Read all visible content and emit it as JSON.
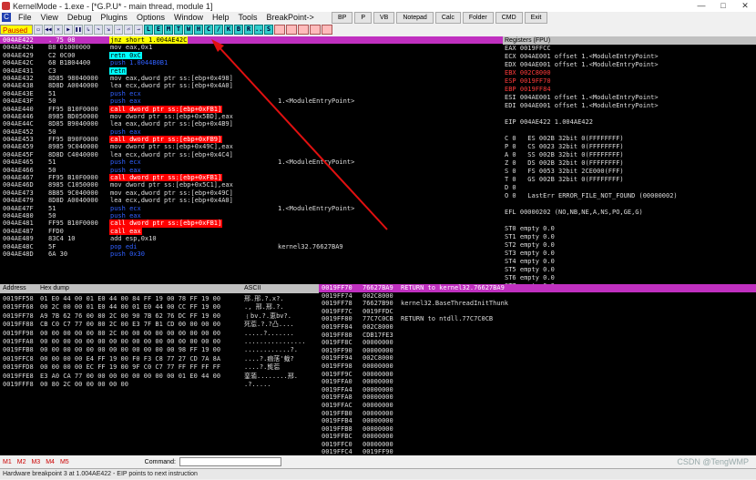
{
  "window": {
    "title": "KernelMode - 1.exe - [*G.P.U* - main thread, module 1]",
    "controls": [
      "—",
      "□",
      "✕"
    ]
  },
  "menu": [
    "File",
    "View",
    "Debug",
    "Plugins",
    "Options",
    "Window",
    "Help",
    "Tools",
    "BreakPoint->"
  ],
  "plugin_buttons": [
    "BP",
    "P",
    "VB",
    "Notepad",
    "Calc",
    "Folder",
    "CMD",
    "Exit"
  ],
  "toolbar": {
    "status": "Paused",
    "letters": [
      "L",
      "E",
      "M",
      "T",
      "W",
      "H",
      "C",
      "/",
      "K",
      "B",
      "R",
      "...",
      "S"
    ],
    "icons": [
      "open-icon",
      "rewind-icon",
      "close-icon",
      "play-icon",
      "pause-icon",
      "step-into-icon",
      "step-over-icon",
      "trace-into-icon",
      "trace-over-icon",
      "exec-till-return-icon",
      "goto-icon"
    ]
  },
  "disasm": {
    "rows": [
      {
        "addr": "004AE422",
        "hex": ". 75 08",
        "ins": "jnz short 1.004AE42C",
        "cmt": "",
        "kind": "jmp",
        "sel": true
      },
      {
        "addr": "004AE424",
        "hex": "B8 01000000",
        "ins": "mov eax,0x1",
        "cmt": "",
        "kind": "plain"
      },
      {
        "addr": "004AE429",
        "hex": "C2 0C00",
        "ins": "retn 0xC",
        "cmt": "",
        "kind": "ret"
      },
      {
        "addr": "004AE42C",
        "hex": "68 B1B04400",
        "ins": "push 1.0044B0B1",
        "cmt": "",
        "kind": "push"
      },
      {
        "addr": "004AE431",
        "hex": "C3",
        "ins": "retn",
        "cmt": "",
        "kind": "ret"
      },
      {
        "addr": "004AE432",
        "hex": "8D85 98040000",
        "ins": "mov eax,dword ptr ss:[ebp+0x498]",
        "cmt": "",
        "kind": "plain"
      },
      {
        "addr": "004AE438",
        "hex": "8D8D A0040000",
        "ins": "lea ecx,dword ptr ss:[ebp+0x4A0]",
        "cmt": "",
        "kind": "plain"
      },
      {
        "addr": "004AE43E",
        "hex": "51",
        "ins": "push ecx",
        "cmt": "",
        "kind": "push"
      },
      {
        "addr": "004AE43F",
        "hex": "50",
        "ins": "push eax",
        "cmt": "1.<ModuleEntryPoint>",
        "kind": "push"
      },
      {
        "addr": "004AE440",
        "hex": "FF95 B10F0000",
        "ins": "call dword ptr ss:[ebp+0xFB1]",
        "cmt": "",
        "kind": "call"
      },
      {
        "addr": "004AE446",
        "hex": "8985 BD050000",
        "ins": "mov dword ptr ss:[ebp+0x5BD],eax",
        "cmt": "",
        "kind": "plain"
      },
      {
        "addr": "004AE44C",
        "hex": "8D85 B9040000",
        "ins": "lea eax,dword ptr ss:[ebp+0x4B9]",
        "cmt": "",
        "kind": "plain"
      },
      {
        "addr": "004AE452",
        "hex": "50",
        "ins": "push eax",
        "cmt": "",
        "kind": "push"
      },
      {
        "addr": "004AE453",
        "hex": "FF95 B90F0000",
        "ins": "call dword ptr ss:[ebp+0xFB9]",
        "cmt": "",
        "kind": "call"
      },
      {
        "addr": "004AE459",
        "hex": "8985 9C040000",
        "ins": "mov dword ptr ss:[ebp+0x49C],eax",
        "cmt": "",
        "kind": "plain"
      },
      {
        "addr": "004AE45F",
        "hex": "8D8D C4040000",
        "ins": "lea ecx,dword ptr ss:[ebp+0x4C4]",
        "cmt": "",
        "kind": "plain"
      },
      {
        "addr": "004AE465",
        "hex": "51",
        "ins": "push ecx",
        "cmt": "1.<ModuleEntryPoint>",
        "kind": "push"
      },
      {
        "addr": "004AE466",
        "hex": "50",
        "ins": "push eax",
        "cmt": "",
        "kind": "push"
      },
      {
        "addr": "004AE467",
        "hex": "FF95 B10F0000",
        "ins": "call dword ptr ss:[ebp+0xFB1]",
        "cmt": "",
        "kind": "call"
      },
      {
        "addr": "004AE46D",
        "hex": "8985 C1050000",
        "ins": "mov dword ptr ss:[ebp+0x5C1],eax",
        "cmt": "",
        "kind": "plain"
      },
      {
        "addr": "004AE473",
        "hex": "8B85 9C040000",
        "ins": "mov eax,dword ptr ss:[ebp+0x49C]",
        "cmt": "",
        "kind": "plain"
      },
      {
        "addr": "004AE479",
        "hex": "8D8D A0040000",
        "ins": "lea ecx,dword ptr ss:[ebp+0x4A0]",
        "cmt": "",
        "kind": "plain"
      },
      {
        "addr": "004AE47F",
        "hex": "51",
        "ins": "push ecx",
        "cmt": "1.<ModuleEntryPoint>",
        "kind": "push"
      },
      {
        "addr": "004AE480",
        "hex": "50",
        "ins": "push eax",
        "cmt": "",
        "kind": "push"
      },
      {
        "addr": "004AE481",
        "hex": "FF95 B10F0000",
        "ins": "call dword ptr ss:[ebp+0xFB1]",
        "cmt": "",
        "kind": "call"
      },
      {
        "addr": "004AE487",
        "hex": "FFD0",
        "ins": "call eax",
        "cmt": "",
        "kind": "call"
      },
      {
        "addr": "004AE489",
        "hex": "83C4 10",
        "ins": "add esp,0x10",
        "cmt": "",
        "kind": "plain"
      },
      {
        "addr": "004AE48C",
        "hex": "5F",
        "ins": "pop edi",
        "cmt": "kernel32.76627BA9",
        "kind": "push"
      },
      {
        "addr": "004AE48D",
        "hex": "6A 30",
        "ins": "push 0x30",
        "cmt": "",
        "kind": "push"
      }
    ]
  },
  "registers": {
    "title": "Registers (FPU)",
    "lines": [
      {
        "t": "EAX 0019FFCC",
        "red": false
      },
      {
        "t": "ECX 004AE001 offset 1.<ModuleEntryPoint>",
        "red": false
      },
      {
        "t": "EDX 004AE001 offset 1.<ModuleEntryPoint>",
        "red": false
      },
      {
        "t": "EBX 002C8000",
        "red": true
      },
      {
        "t": "ESP 0019FF70",
        "red": true
      },
      {
        "t": "EBP 0019FF84",
        "red": true
      },
      {
        "t": "ESI 004AE001 offset 1.<ModuleEntryPoint>",
        "red": false
      },
      {
        "t": "EDI 004AE001 offset 1.<ModuleEntryPoint>",
        "red": false
      },
      {
        "t": "",
        "red": false
      },
      {
        "t": "EIP 004AE422 1.004AE422",
        "red": false
      },
      {
        "t": "",
        "red": false
      },
      {
        "t": "C 0   ES 002B 32bit 0(FFFFFFFF)",
        "red": false
      },
      {
        "t": "P 0   CS 0023 32bit 0(FFFFFFFF)",
        "red": false
      },
      {
        "t": "A 0   SS 002B 32bit 0(FFFFFFFF)",
        "red": false
      },
      {
        "t": "Z 0   DS 002B 32bit 0(FFFFFFFF)",
        "red": false
      },
      {
        "t": "S 0   FS 0053 32bit 2CE000(FFF)",
        "red": false
      },
      {
        "t": "T 0   GS 002B 32bit 0(FFFFFFFF)",
        "red": false
      },
      {
        "t": "D 0",
        "red": false
      },
      {
        "t": "O 0   LastErr ERROR_FILE_NOT_FOUND (00000002)",
        "red": false
      },
      {
        "t": "",
        "red": false
      },
      {
        "t": "EFL 00000202 (NO,NB,NE,A,NS,PO,GE,G)",
        "red": false
      },
      {
        "t": "",
        "red": false
      },
      {
        "t": "ST0 empty 0.0",
        "red": false
      },
      {
        "t": "ST1 empty 0.0",
        "red": false
      },
      {
        "t": "ST2 empty 0.0",
        "red": false
      },
      {
        "t": "ST3 empty 0.0",
        "red": false
      },
      {
        "t": "ST4 empty 0.0",
        "red": false
      },
      {
        "t": "ST5 empty 0.0",
        "red": false
      },
      {
        "t": "ST6 empty 0.0",
        "red": false
      },
      {
        "t": "ST7 empty 0.0",
        "red": false
      }
    ]
  },
  "dump": {
    "headers": [
      "Address",
      "Hex dump",
      "ASCII"
    ],
    "rows": [
      {
        "a": "0019FF58",
        "h": "01 E0 44 00 01 E0 44 00 84 FF 19 00 78 FF 19 00",
        "s": "邢.邢.?.x?."
      },
      {
        "a": "0019FF68",
        "h": "00 2C 00 00 01 E0 44 00 01 E0 44 00 CC FF 19 00",
        "s": "., 邢.邢.?."
      },
      {
        "a": "0019FF78",
        "h": "A9 7B 62 76 00 80 2C 00 90 7B 62 76 DC FF 19 00",
        "s": "﹛bv.?.恵bv?."
      },
      {
        "a": "0019FF88",
        "h": "CB C0 C7 77 00 80 2C 00 E3 7F B1 CD 00 00 00 00",
        "s": "死莣.?.?凸...."
      },
      {
        "a": "0019FF98",
        "h": "00 00 00 00 00 80 2C 00 00 00 00 00 00 00 00 00",
        "s": ".....?......."
      },
      {
        "a": "0019FFA8",
        "h": "00 00 00 00 00 00 00 00 00 00 00 00 00 00 00 00",
        "s": "................"
      },
      {
        "a": "0019FFB8",
        "h": "00 00 00 00 00 00 00 00 00 00 00 00 98 FF 19 00",
        "s": "............?."
      },
      {
        "a": "0019FFC8",
        "h": "00 00 00 00 E4 FF 19 00 F0 F3 C8 77 27 CD 7A 8A",
        "s": "....?.痼萿'蛓?"
      },
      {
        "a": "0019FFD8",
        "h": "00 00 00 00 EC FF 19 00 9F C0 C7 77 FF FF FF FF",
        "s": "....?.熋莣"
      },
      {
        "a": "0019FFE8",
        "h": "E3 A0 CA 77 00 00 00 00 00 00 00 00 01 E0 44 00",
        "s": "銮蕍........邢."
      },
      {
        "a": "0019FFF8",
        "h": "00 80 2C 00 00 00 00 00",
        "s": ".?....."
      }
    ]
  },
  "stack": {
    "rows": [
      {
        "a": "0019FF70",
        "v": "76627BA9",
        "c": "RETURN to kernel32.76627BA9",
        "sel": true
      },
      {
        "a": "0019FF74",
        "v": "002C8000",
        "c": ""
      },
      {
        "a": "0019FF78",
        "v": "76627B90",
        "c": "kernel32.BaseThreadInitThunk"
      },
      {
        "a": "0019FF7C",
        "v": "0019FFDC",
        "c": ""
      },
      {
        "a": "0019FF80",
        "v": "77C7C0CB",
        "c": "RETURN to ntdll.77C7C0CB"
      },
      {
        "a": "0019FF84",
        "v": "002C8000",
        "c": ""
      },
      {
        "a": "0019FF88",
        "v": "CDB17FE3",
        "c": ""
      },
      {
        "a": "0019FF8C",
        "v": "00000000",
        "c": ""
      },
      {
        "a": "0019FF90",
        "v": "00000000",
        "c": ""
      },
      {
        "a": "0019FF94",
        "v": "002C8000",
        "c": ""
      },
      {
        "a": "0019FF98",
        "v": "00000000",
        "c": ""
      },
      {
        "a": "0019FF9C",
        "v": "00000000",
        "c": ""
      },
      {
        "a": "0019FFA0",
        "v": "00000000",
        "c": ""
      },
      {
        "a": "0019FFA4",
        "v": "00000000",
        "c": ""
      },
      {
        "a": "0019FFA8",
        "v": "00000000",
        "c": ""
      },
      {
        "a": "0019FFAC",
        "v": "00000000",
        "c": ""
      },
      {
        "a": "0019FFB0",
        "v": "00000000",
        "c": ""
      },
      {
        "a": "0019FFB4",
        "v": "00000000",
        "c": ""
      },
      {
        "a": "0019FFB8",
        "v": "00000000",
        "c": ""
      },
      {
        "a": "0019FFBC",
        "v": "00000000",
        "c": ""
      },
      {
        "a": "0019FFC0",
        "v": "00000000",
        "c": ""
      },
      {
        "a": "0019FFC4",
        "v": "0019FF90",
        "c": ""
      }
    ]
  },
  "command": {
    "tabs": [
      "M1",
      "M2",
      "M3",
      "M4",
      "M5"
    ],
    "label": "Command:",
    "value": ""
  },
  "status": "Hardware breakpoint 3 at 1.004AE422 - EIP points to next instruction",
  "watermark": "CSDN @TengWMP"
}
